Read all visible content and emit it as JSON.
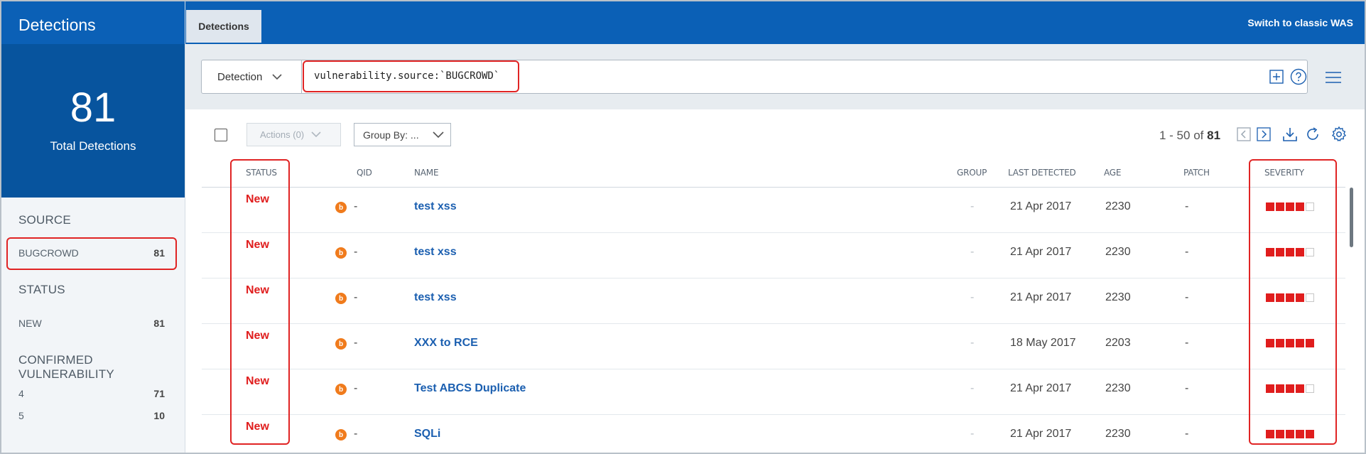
{
  "sidebar": {
    "title": "Detections",
    "total": "81",
    "total_label": "Total Detections",
    "facets": [
      {
        "title": "SOURCE",
        "items": [
          {
            "label": "BUGCROWD",
            "count": "81"
          }
        ]
      },
      {
        "title": "STATUS",
        "items": [
          {
            "label": "NEW",
            "count": "81"
          }
        ]
      },
      {
        "title": "CONFIRMED VULNERABILITY",
        "items": [
          {
            "label": "4",
            "count": "71"
          },
          {
            "label": "5",
            "count": "10"
          }
        ]
      }
    ]
  },
  "topbar": {
    "tab": "Detections",
    "switch_link": "Switch to classic WAS"
  },
  "search": {
    "dropdown": "Detection",
    "query": "vulnerability.source:`BUGCROWD`"
  },
  "toolbar": {
    "actions": "Actions (0)",
    "group_by": "Group By: ...",
    "pager_range": "1 - 50 of",
    "pager_total": "81"
  },
  "table": {
    "columns": [
      "STATUS",
      "QID",
      "NAME",
      "GROUP",
      "LAST DETECTED",
      "AGE",
      "PATCH",
      "SEVERITY"
    ],
    "rows": [
      {
        "status": "New",
        "source_icon": "b",
        "qid": "-",
        "name": "test xss",
        "group": "-",
        "last_detected": "21 Apr 2017",
        "age": "2230",
        "patch": "-",
        "severity": 4
      },
      {
        "status": "New",
        "source_icon": "b",
        "qid": "-",
        "name": "test xss",
        "group": "-",
        "last_detected": "21 Apr 2017",
        "age": "2230",
        "patch": "-",
        "severity": 4
      },
      {
        "status": "New",
        "source_icon": "b",
        "qid": "-",
        "name": "test xss",
        "group": "-",
        "last_detected": "21 Apr 2017",
        "age": "2230",
        "patch": "-",
        "severity": 4
      },
      {
        "status": "New",
        "source_icon": "b",
        "qid": "-",
        "name": "XXX to RCE",
        "group": "-",
        "last_detected": "18 May 2017",
        "age": "2203",
        "patch": "-",
        "severity": 5
      },
      {
        "status": "New",
        "source_icon": "b",
        "qid": "-",
        "name": "Test ABCS Duplicate",
        "group": "-",
        "last_detected": "21 Apr 2017",
        "age": "2230",
        "patch": "-",
        "severity": 4
      },
      {
        "status": "New",
        "source_icon": "b",
        "qid": "-",
        "name": "SQLi",
        "group": "-",
        "last_detected": "21 Apr 2017",
        "age": "2230",
        "patch": "-",
        "severity": 5
      }
    ]
  },
  "colors": {
    "brand_blue": "#0b60b6",
    "panel_blue": "#07549e",
    "status_red": "#e01d1d",
    "link_blue": "#1b5fb0",
    "bugcrowd_orange": "#f07b1c",
    "highlight_red": "#e02424"
  },
  "icons": [
    "chevron-down-icon",
    "add-query-icon",
    "help-icon",
    "menu-icon",
    "prev-page-icon",
    "next-page-icon",
    "download-icon",
    "refresh-icon",
    "settings-icon",
    "bugcrowd-icon"
  ]
}
